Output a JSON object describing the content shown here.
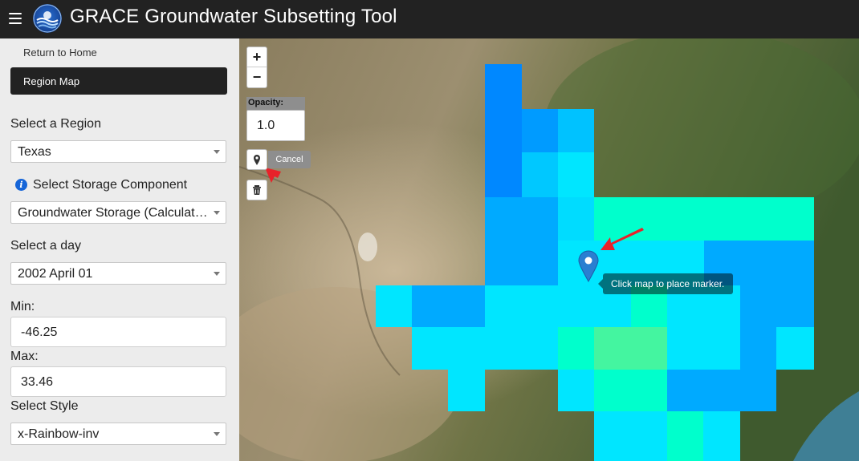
{
  "header": {
    "title": "GRACE Groundwater Subsetting Tool"
  },
  "sidebar": {
    "home_link": "Return to Home",
    "region_map_button": "Region Map",
    "region": {
      "label": "Select a Region",
      "value": "Texas"
    },
    "storage": {
      "label": "Select Storage Component",
      "value": "Groundwater Storage (Calculated)"
    },
    "day": {
      "label": "Select a day",
      "value": "2002 April 01"
    },
    "min": {
      "label": "Min:",
      "value": "-46.25"
    },
    "max": {
      "label": "Max:",
      "value": "33.46"
    },
    "style": {
      "label": "Select Style",
      "value": "x-Rainbow-inv"
    }
  },
  "map": {
    "zoom_in": "+",
    "zoom_out": "−",
    "opacity_label": "Opacity:",
    "opacity_value": "1.0",
    "cancel_label": "Cancel",
    "tooltip": "Click map to place marker."
  },
  "colors": {
    "header_bg": "#222222",
    "accent_arrow": "#e8222a",
    "marker": "#2a7fd1"
  },
  "icons": [
    "menu-icon",
    "grace-logo",
    "info-icon",
    "map-marker-icon",
    "trash-icon",
    "dropdown-arrow-icon"
  ]
}
